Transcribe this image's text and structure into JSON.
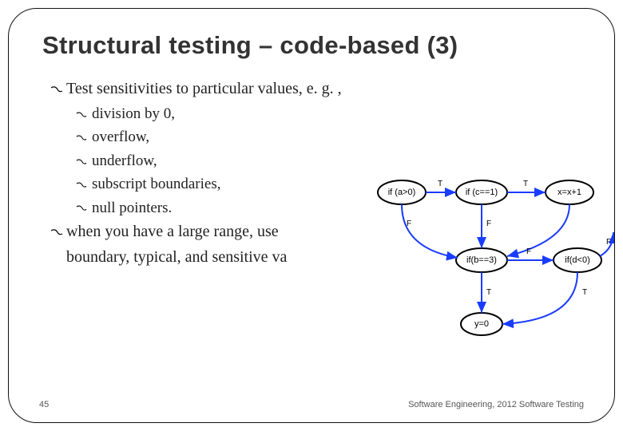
{
  "title": "Structural testing – code-based (3)",
  "bullets": {
    "item1": "Test sensitivities to particular values, e. g. ,",
    "sub": {
      "a": "division by 0,",
      "b": "overflow,",
      "c": "underflow,",
      "d": "subscript boundaries,",
      "e": "null pointers."
    },
    "item2a": "when you have a large range, use",
    "item2b": "boundary, typical, and sensitive va"
  },
  "footer": {
    "pageno": "45",
    "right": "Software Engineering,   2012 Software  Testing"
  },
  "diagram": {
    "nodes": {
      "n1": "if (a>0)",
      "n2": "if (c==1)",
      "n3": "x=x+1",
      "n4": "if(b==3)",
      "n5": "if(d<0)",
      "n6": "y=0"
    },
    "labels": {
      "T": "T",
      "F": "F"
    }
  }
}
